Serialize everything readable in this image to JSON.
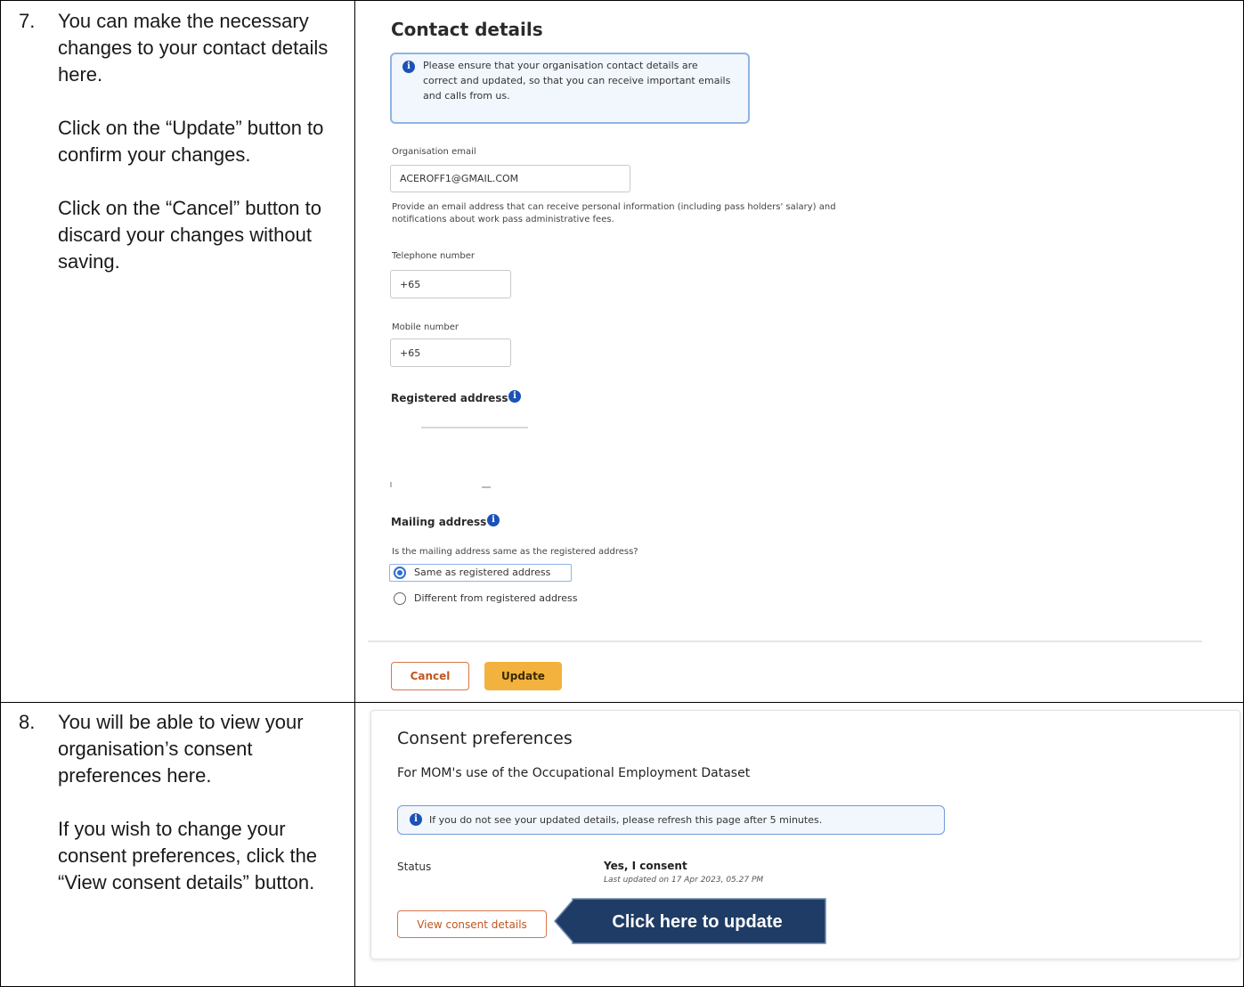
{
  "step7": {
    "number": "7.",
    "line1": "You can make the necessary changes to your contact details here.",
    "line2": "Click on the “Update” button to confirm your changes.",
    "line3": "Click on the “Cancel” button to discard your changes without saving."
  },
  "contact": {
    "title": "Contact details",
    "notice": "Please ensure that your organisation contact details are correct and updated, so that you can receive important emails and calls from us.",
    "email_label": "Organisation email",
    "email_value": "ACEROFF1@GMAIL.COM",
    "email_help_1": "Provide an email address that can receive personal information (including pass holders' salary) and",
    "email_help_2": "notifications about work pass administrative fees.",
    "tel_label": "Telephone number",
    "tel_value": "+65",
    "mobile_label": "Mobile number",
    "mobile_value": "+65",
    "registered_title": "Registered address",
    "mailing_title": "Mailing address",
    "mailing_question": "Is the mailing address same as the registered address?",
    "option_same": "Same as registered address",
    "option_diff": "Different from registered address",
    "cancel_label": "Cancel",
    "update_label": "Update"
  },
  "step8": {
    "number": "8.",
    "line1": "You will be able to view your organisation’s consent preferences here.",
    "line2": "If you wish to change your consent preferences, click the “View consent details” button."
  },
  "consent": {
    "title": "Consent preferences",
    "subtitle": "For MOM's use of the Occupational Employment Dataset",
    "notice": "If you do not see your updated details, please refresh this page after 5 minutes.",
    "status_label": "Status",
    "status_value": "Yes, I consent",
    "last_updated": "Last updated on 17 Apr 2023, 05.27 PM",
    "view_button": "View consent details",
    "callout": "Click here to update"
  },
  "colors": {
    "accent_blue": "#1b52b8",
    "update_orange": "#f3b23d",
    "callout_navy": "#1f3c66"
  }
}
